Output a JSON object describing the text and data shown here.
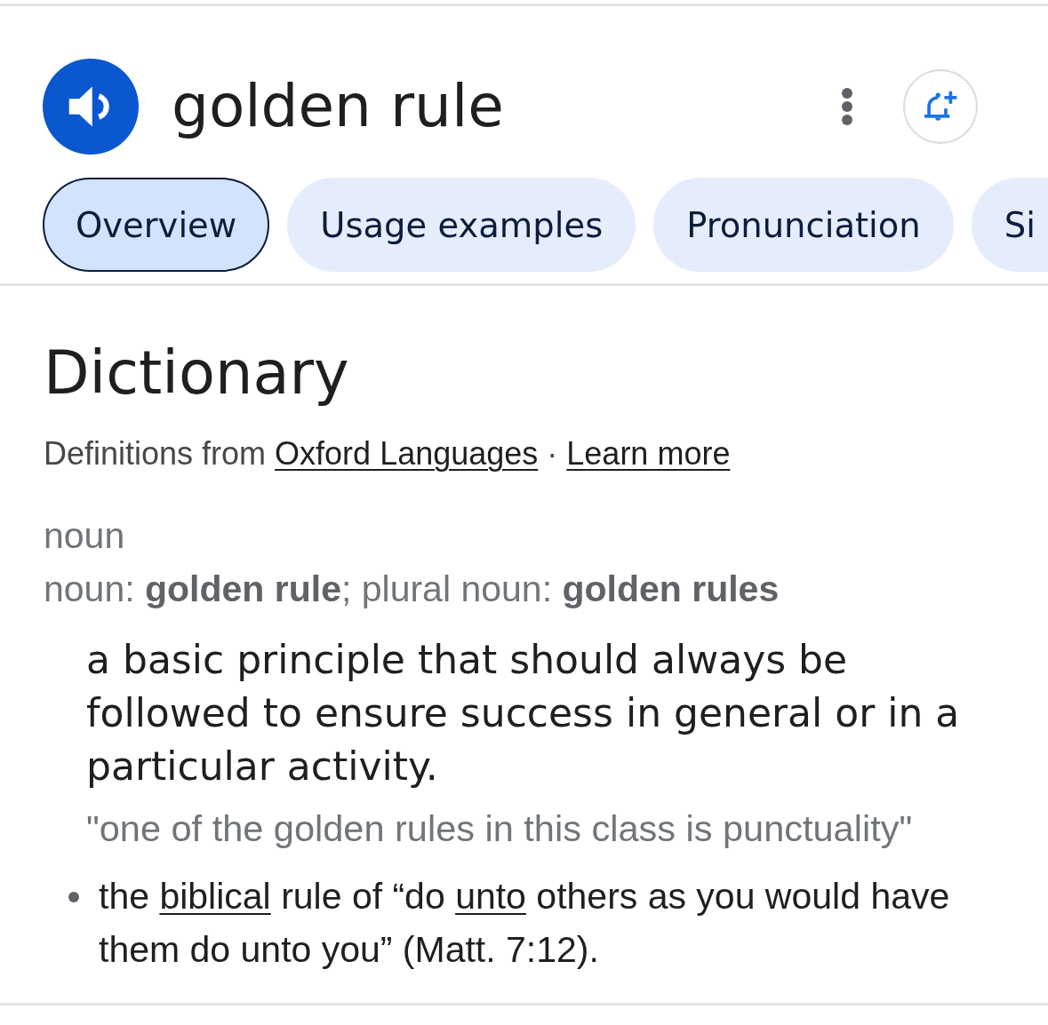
{
  "header": {
    "title": "golden rule"
  },
  "tabs": [
    {
      "label": "Overview",
      "selected": true
    },
    {
      "label": "Usage examples",
      "selected": false
    },
    {
      "label": "Pronunciation",
      "selected": false
    },
    {
      "label": "Si",
      "selected": false
    }
  ],
  "dictionary": {
    "heading": "Dictionary",
    "source": [
      {
        "kind": "text",
        "text": "Definitions from "
      },
      {
        "kind": "link",
        "text": "Oxford Languages"
      },
      {
        "kind": "text",
        "text": " · "
      },
      {
        "kind": "link",
        "text": "Learn more"
      }
    ],
    "part_of_speech": "noun",
    "forms": "noun: **golden rule**; plural noun: **golden rules**",
    "senses": [
      {
        "definition": "a basic principle that should always be followed to ensure success in general or in a particular activity.",
        "example": "\"one of the golden rules in this class is punctuality\"",
        "subsenses": [
          {
            "parts": [
              {
                "kind": "text",
                "text": "the "
              },
              {
                "kind": "link",
                "text": "biblical"
              },
              {
                "kind": "text",
                "text": " rule of “do "
              },
              {
                "kind": "link",
                "text": "unto"
              },
              {
                "kind": "text",
                "text": " others as you would have them do unto you” (Matt. 7:12)."
              }
            ]
          }
        ]
      }
    ]
  }
}
